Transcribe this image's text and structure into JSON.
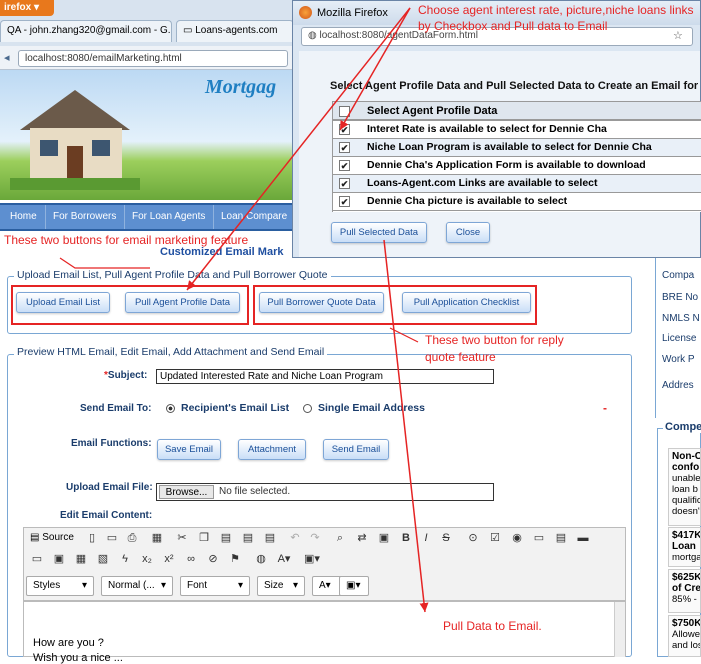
{
  "browser": {
    "firefox_label": "irefox",
    "tabs": [
      "QA - john.zhang320@gmail.com - G...",
      "Loans-agents.com"
    ],
    "url": "localhost:8080/emailMarketing.html"
  },
  "site": {
    "logo": "Mortgag",
    "nav": [
      "Home",
      "For Borrowers",
      "For Loan Agents",
      "Loan Compare"
    ],
    "subtitle": "Customized Email Mark"
  },
  "upload_section": {
    "legend": "Upload Email List, Pull Agent Profile Data and Pull Borrower Quote",
    "buttons": [
      "Upload Email List",
      "Pull Agent Profile Data",
      "Pull Borrower Quote Data",
      "Pull Application Checklist"
    ]
  },
  "preview_section": {
    "legend": "Preview HTML Email, Edit Email, Add Attachment and Send Email",
    "subject_label": "Subject:",
    "subject_required": "*",
    "subject_value": "Updated Interested Rate and Niche Loan Program",
    "send_to_label": "Send Email To:",
    "recipient_option": "Recipient's Email List",
    "single_option": "Single Email Address",
    "functions_label": "Email Functions:",
    "function_buttons": [
      "Save Email",
      "Attachment",
      "Send Email"
    ],
    "upload_file_label": "Upload Email File:",
    "browse_label": "Browse...",
    "no_file_text": "No file selected.",
    "edit_content_label": "Edit Email Content:"
  },
  "editor": {
    "source_label": "Source",
    "combos": [
      "Styles",
      "Normal (...",
      "Font",
      "Size"
    ],
    "body_line1": "How are you ?",
    "body_line2": "Wish you a nice ..."
  },
  "popup": {
    "window_title": "Mozilla Firefox",
    "url": "localhost:8080/agentDataForm.html",
    "heading": "Select Agent Profile Data and Pull Selected Data to Create an Email for D",
    "table_header": "Select Agent Profile Data",
    "rows": [
      "Interet Rate is available to select for Dennie Cha",
      "Niche Loan Program is available to select for Dennie Cha",
      "Dennie Cha's Application Form is available to download",
      "Loans-Agent.com Links are available to select",
      "Dennie Cha picture is available to select"
    ],
    "pull_button": "Pull Selected Data",
    "close_button": "Close"
  },
  "right_sidebar": {
    "items": [
      "Compa",
      "BRE No",
      "NMLS N",
      "License",
      "Work P",
      "Addres"
    ],
    "compare_header": "Compe",
    "offers": [
      {
        "title": "Non-C",
        "title2": "confo",
        "lines": [
          "unable",
          "loan b",
          "qualific",
          "doesn't"
        ]
      },
      {
        "title": "$417K",
        "title2": "Loan",
        "lines": [
          "mortga"
        ]
      },
      {
        "title": "$625K",
        "title2": "of Cre",
        "lines": [
          "85% -"
        ]
      },
      {
        "title": "$750K",
        "title2": "",
        "lines": [
          "Allowe",
          "and los"
        ]
      }
    ]
  },
  "annotations": {
    "top": "Choose agent interest rate, picture,niche loans links by Checkbox and Pull data to Email",
    "email_marketing": "These two buttons for email marketing feature",
    "reply_quote": "These two button for reply quote feature",
    "pull_data": "Pull Data to Email.",
    "dash": "-"
  },
  "colors": {
    "annotation": "#e52424",
    "nav": "#5d8fd0",
    "link": "#1a4f99"
  }
}
